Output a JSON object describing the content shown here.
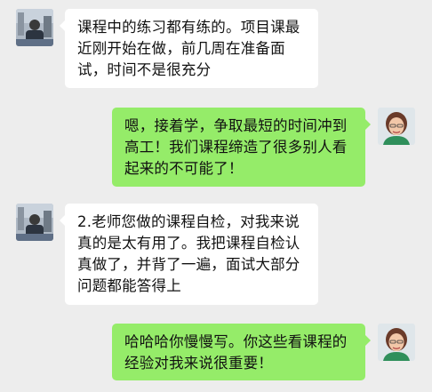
{
  "chat": {
    "messages": [
      {
        "sender": "other",
        "lines": [
          "课程中的练习都有练的。项目课最",
          "近刚开始在做，前几周在准备面",
          "试，时间不是很充分"
        ]
      },
      {
        "sender": "self",
        "lines": [
          "嗯，接着学，争取最短的时间冲到",
          "高工！我们课程缔造了很多别人看",
          "起来的不可能了！"
        ]
      },
      {
        "sender": "other",
        "lines": [
          "2.老师您做的课程自检，对我来说",
          "真的是太有用了。我把课程自检认",
          "真做了，并背了一遍，面试大部分",
          "问题都能答得上"
        ]
      },
      {
        "sender": "self",
        "lines": [
          "哈哈哈你慢慢写。你这些看课程的",
          "经验对我来说很重要！"
        ]
      }
    ]
  },
  "colors": {
    "background": "#ededed",
    "incoming_bubble": "#ffffff",
    "outgoing_bubble": "#95ec69"
  }
}
